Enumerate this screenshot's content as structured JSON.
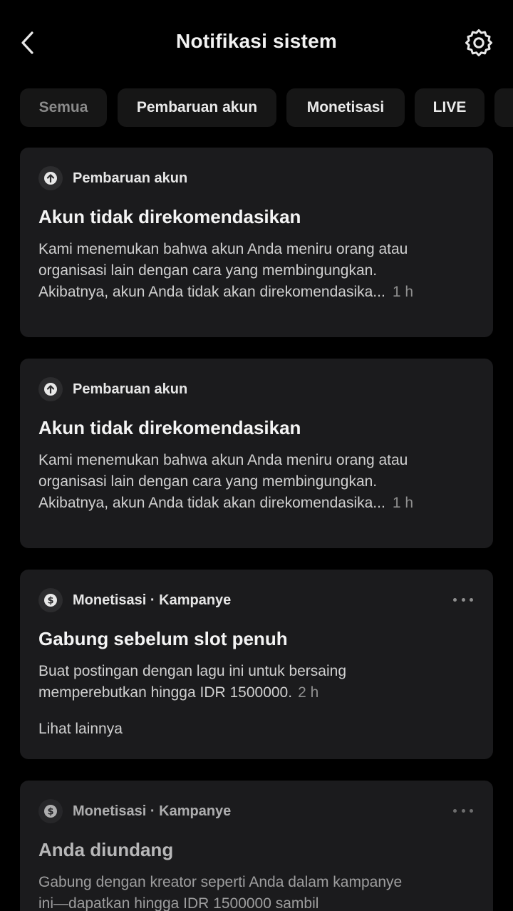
{
  "header": {
    "title": "Notifikasi sistem",
    "back_icon": "chevron-left-icon",
    "settings_icon": "gear-icon"
  },
  "tabs": [
    {
      "label": "Semua"
    },
    {
      "label": "Pembaruan akun"
    },
    {
      "label": "Monetisasi"
    },
    {
      "label": "LIVE"
    }
  ],
  "notifications": [
    {
      "category": "Pembaruan akun",
      "icon": "arrow-up-circle-icon",
      "title": "Akun tidak direkomendasikan",
      "lines": [
        "Kami menemukan bahwa akun Anda meniru orang atau",
        "organisasi lain dengan cara yang membingungkan.",
        "Akibatnya, akun Anda tidak akan direkomendasika..."
      ],
      "time": "1 h"
    },
    {
      "category": "Pembaruan akun",
      "icon": "arrow-up-circle-icon",
      "title": "Akun tidak direkomendasikan",
      "lines": [
        "Kami menemukan bahwa akun Anda meniru orang atau",
        "organisasi lain dengan cara yang membingungkan.",
        "Akibatnya, akun Anda tidak akan direkomendasika..."
      ],
      "time": "1 h"
    },
    {
      "category": "Monetisasi · Kampanye",
      "icon": "dollar-circle-icon",
      "title": "Gabung sebelum slot penuh",
      "lines": [
        "Buat postingan dengan lagu ini untuk bersaing",
        "memperebutkan hingga IDR 1500000."
      ],
      "time": "2 h",
      "see_more": "Lihat lainnya"
    },
    {
      "category": "Monetisasi · Kampanye",
      "icon": "dollar-circle-icon",
      "title": "Anda diundang",
      "lines": [
        "Gabung dengan kreator seperti Anda dalam kampanye",
        "ini—dapatkan hingga IDR 1500000 sambil"
      ]
    }
  ]
}
